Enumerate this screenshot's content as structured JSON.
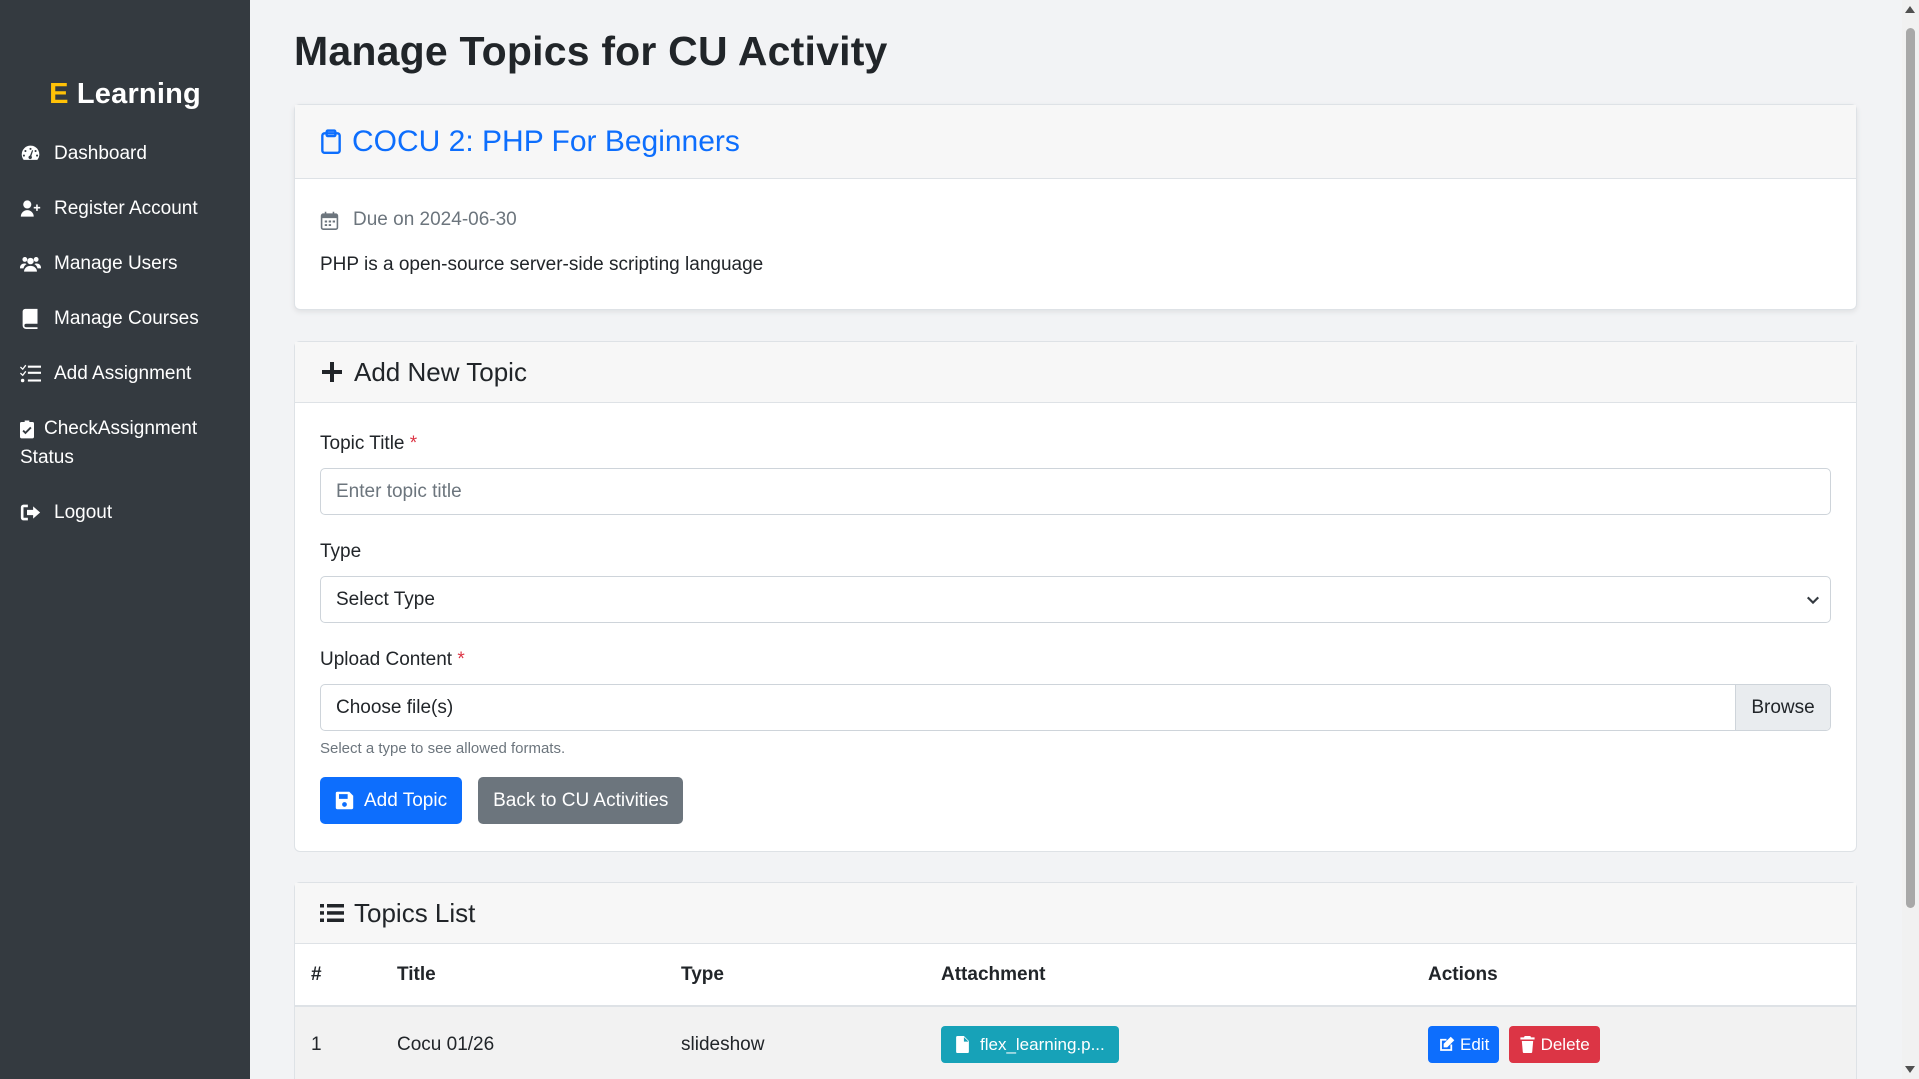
{
  "brand": {
    "prefix": "E",
    "name": "Learning"
  },
  "sidebar": {
    "items": [
      {
        "label": "Dashboard",
        "icon": "tachometer-icon"
      },
      {
        "label": "Register Account",
        "icon": "user-plus-icon"
      },
      {
        "label": "Manage Users",
        "icon": "users-icon"
      },
      {
        "label": "Manage Courses",
        "icon": "book-icon"
      },
      {
        "label": "Add Assignment",
        "icon": "list-check-icon"
      },
      {
        "label": "CheckAssignment Status",
        "icon": "clipboard-check-icon"
      },
      {
        "label": "Logout",
        "icon": "sign-out-icon"
      }
    ]
  },
  "page": {
    "title": "Manage Topics for CU Activity"
  },
  "activity": {
    "title": "COCU 2: PHP For Beginners",
    "due": "Due on 2024-06-30",
    "description": "PHP is a open-source server-side scripting language"
  },
  "form": {
    "header": "Add New Topic",
    "topic_title_label": "Topic Title",
    "required_mark": "*",
    "topic_title_placeholder": "Enter topic title",
    "type_label": "Type",
    "type_selected": "Select Type",
    "upload_label": "Upload Content",
    "file_text": "Choose file(s)",
    "browse_label": "Browse",
    "help_text": "Select a type to see allowed formats.",
    "add_button": "Add Topic",
    "back_button": "Back to CU Activities"
  },
  "topics": {
    "header": "Topics List",
    "columns": [
      "#",
      "Title",
      "Type",
      "Attachment",
      "Actions"
    ],
    "rows": [
      {
        "num": "1",
        "title": "Cocu 01/26",
        "type": "slideshow",
        "attachment": "flex_learning.p...",
        "edit": "Edit",
        "delete": "Delete"
      }
    ]
  }
}
